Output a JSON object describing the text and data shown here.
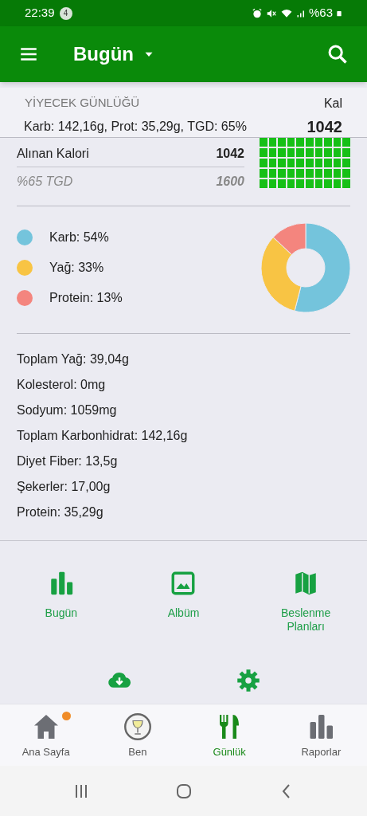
{
  "status_bar": {
    "time": "22:39",
    "notification_count": "4",
    "battery": "%63"
  },
  "app_bar": {
    "title": "Bugün"
  },
  "summary": {
    "heading": "YİYECEK GÜNLÜĞÜ",
    "macros": "Karb: 142,16g, Prot: 35,29g, TGD: 65%",
    "cal_label": "Kal",
    "cal_value": "1042"
  },
  "calories": {
    "consumed_label": "Alınan Kalori",
    "consumed_value": "1042",
    "goal_label": "%65 TGD",
    "goal_value": "1600"
  },
  "macro_legend": [
    {
      "label": "Karb: 54%",
      "color": "#74c4dc"
    },
    {
      "label": "Yağ: 33%",
      "color": "#f8c444"
    },
    {
      "label": "Protein: 13%",
      "color": "#f4857e"
    }
  ],
  "chart_data": {
    "type": "donut",
    "values": [
      54,
      33,
      13
    ]
  },
  "nutrients": [
    "Toplam Yağ: 39,04g",
    "Kolesterol: 0mg",
    "Sodyum: 1059mg",
    "Toplam Karbonhidrat: 142,16g",
    "Diyet Fiber: 13,5g",
    "Şekerler: 17,00g",
    "Protein: 35,29g"
  ],
  "shortcuts": [
    {
      "kind": "bars",
      "label": "Bugün"
    },
    {
      "kind": "image",
      "label": "Albüm"
    },
    {
      "kind": "map",
      "label": "Beslenme Planları"
    }
  ],
  "actions": [
    {
      "kind": "cloud"
    },
    {
      "kind": "gear"
    }
  ],
  "bottom_nav": [
    {
      "kind": "home",
      "label": "Ana Sayfa",
      "selected": false,
      "notification": true
    },
    {
      "kind": "avatar",
      "label": "Ben",
      "selected": false,
      "notification": false
    },
    {
      "kind": "fork",
      "label": "Günlük",
      "selected": true,
      "notification": false
    },
    {
      "kind": "bars",
      "label": "Raporlar",
      "selected": false,
      "notification": false
    }
  ]
}
